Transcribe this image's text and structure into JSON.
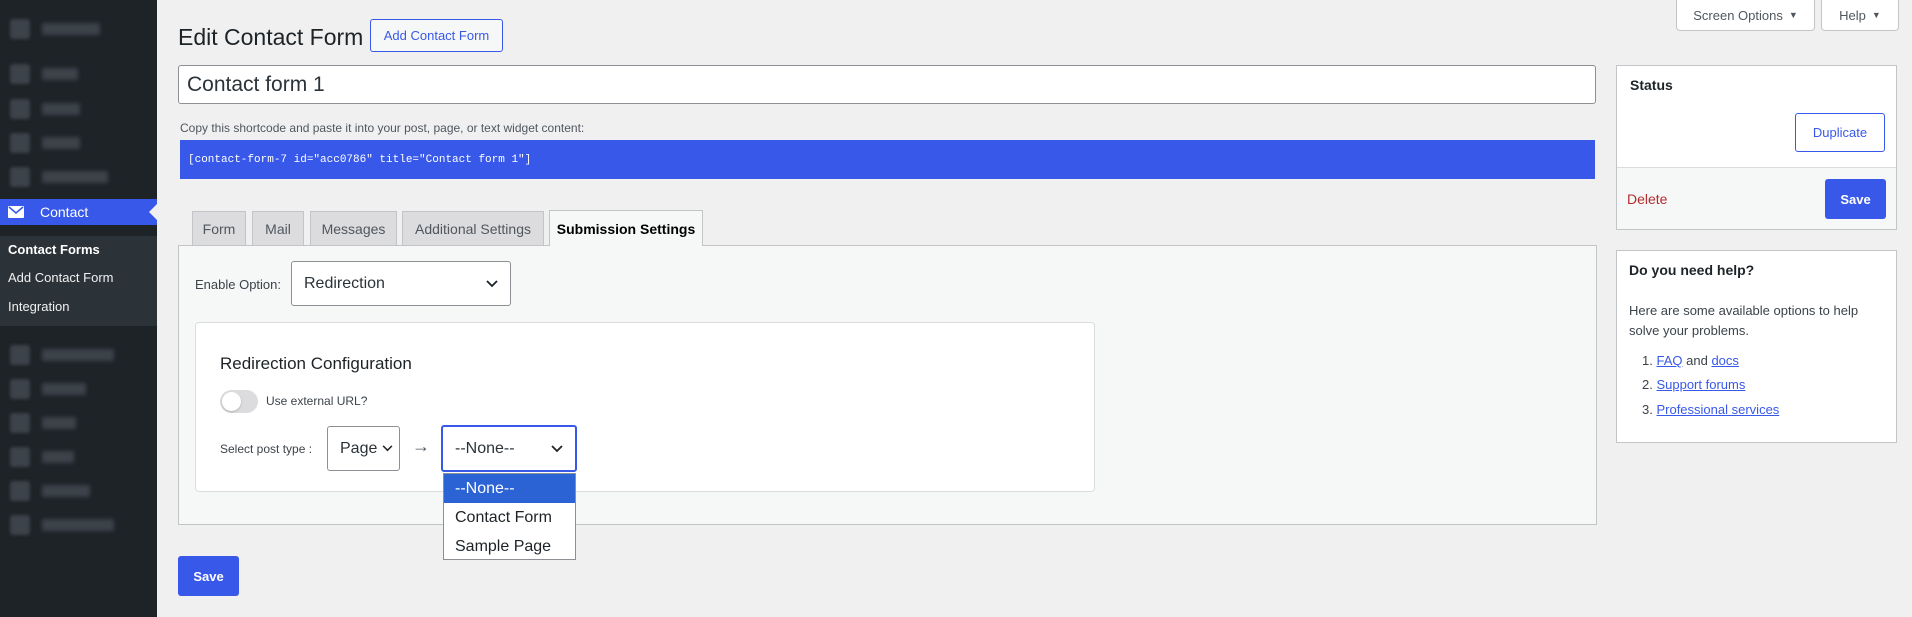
{
  "sidebar": {
    "contact_label": "Contact",
    "submenu": [
      "Contact Forms",
      "Add Contact Form",
      "Integration"
    ]
  },
  "top_buttons": {
    "screen_options": "Screen Options",
    "help": "Help"
  },
  "header": {
    "title": "Edit Contact Form",
    "add_new": "Add Contact Form"
  },
  "form": {
    "title_value": "Contact form 1",
    "shortcode_desc": "Copy this shortcode and paste it into your post, page, or text widget content:",
    "shortcode": "[contact-form-7 id=\"acc0786\" title=\"Contact form 1\"]"
  },
  "tabs": [
    {
      "label": "Form"
    },
    {
      "label": "Mail"
    },
    {
      "label": "Messages"
    },
    {
      "label": "Additional Settings"
    },
    {
      "label": "Submission Settings"
    }
  ],
  "submission": {
    "enable_label": "Enable Option:",
    "enable_value": "Redirection",
    "config_title": "Redirection Configuration",
    "toggle_label": "Use external URL?",
    "post_type_label": "Select post type :",
    "post_type_value": "Page",
    "page_value": "--None--",
    "page_options": [
      "--None--",
      "Contact Form",
      "Sample Page"
    ]
  },
  "save_label": "Save",
  "status": {
    "title": "Status",
    "duplicate": "Duplicate",
    "delete": "Delete",
    "save": "Save"
  },
  "help": {
    "title": "Do you need help?",
    "text": "Here are some available options to help solve your problems.",
    "faq": "FAQ",
    "and": "and",
    "docs": "docs",
    "support": "Support forums",
    "professional": "Professional services"
  },
  "colors": {
    "accent": "#3858e9",
    "sidebar_bg": "#1d2327",
    "delete": "#b32d2e"
  }
}
